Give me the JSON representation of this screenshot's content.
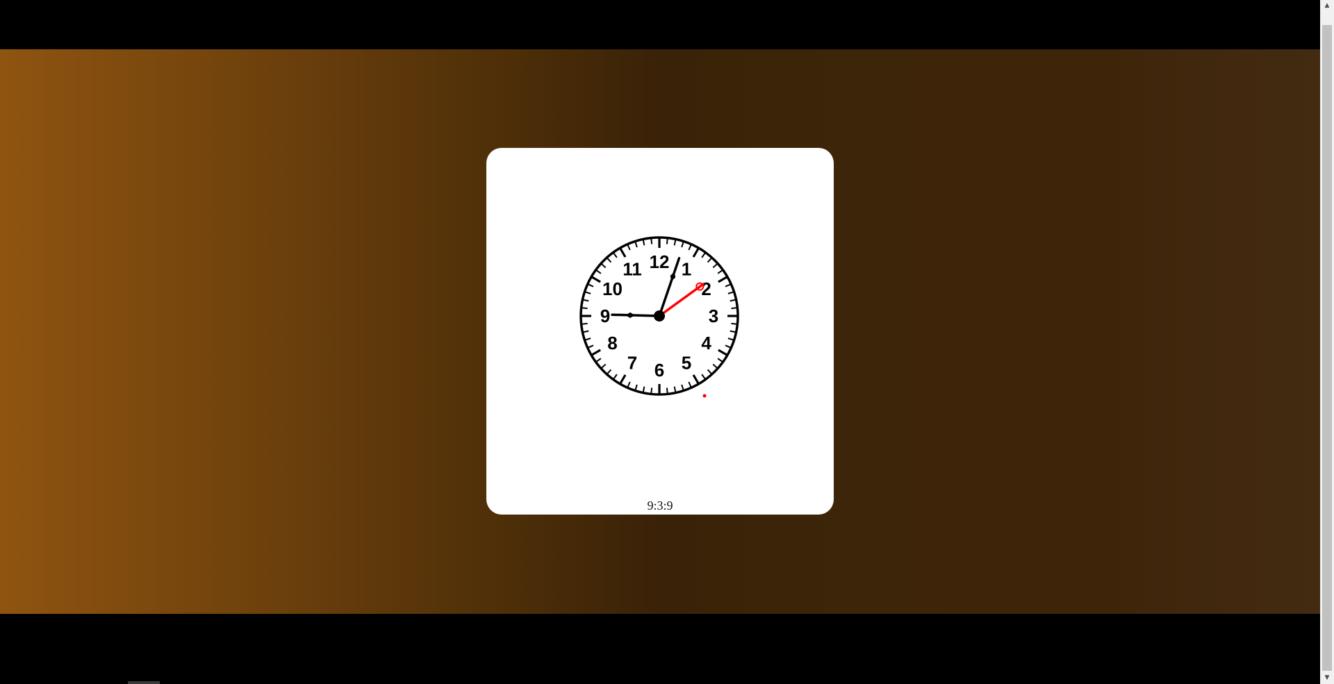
{
  "clock": {
    "numerals": [
      "12",
      "1",
      "2",
      "3",
      "4",
      "5",
      "6",
      "7",
      "8",
      "9",
      "10",
      "11"
    ],
    "time_readout": "9:3:9",
    "hours": 9,
    "minutes": 3,
    "seconds": 9,
    "colors": {
      "hour_hand": "#000000",
      "minute_hand": "#000000",
      "second_hand": "#ff0000",
      "face": "#ffffff",
      "ticks": "#000000"
    }
  },
  "background": {
    "gradient_colors": [
      "#8f5410",
      "#3a2208",
      "#432b12"
    ]
  },
  "icons": {
    "scroll_up": "▲",
    "scroll_down": "▼"
  }
}
